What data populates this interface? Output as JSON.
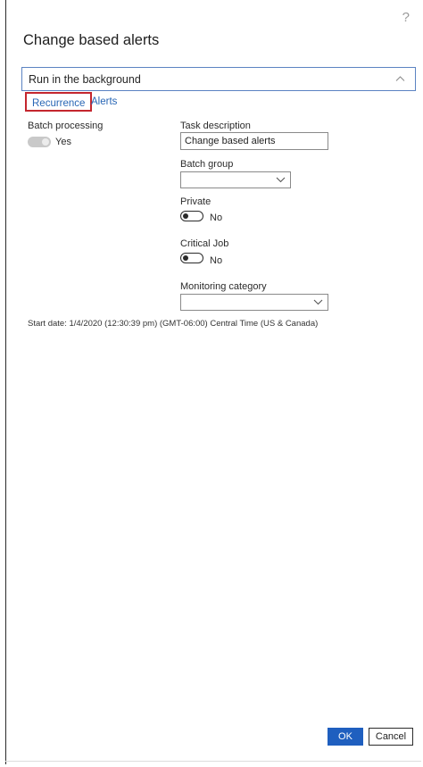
{
  "dialog": {
    "title": "Change based alerts",
    "help_glyph": "?"
  },
  "section": {
    "title": "Run in the background",
    "collapse_icon": "chevron-up-icon"
  },
  "tabs": [
    {
      "label": "Recurrence",
      "highlighted": true
    },
    {
      "label": "Alerts",
      "highlighted": false
    }
  ],
  "batch_processing": {
    "label": "Batch processing",
    "value": "Yes",
    "enabled": false
  },
  "task_description": {
    "label": "Task description",
    "value": "Change based alerts"
  },
  "batch_group": {
    "label": "Batch group",
    "value": ""
  },
  "private": {
    "label": "Private",
    "value": "No"
  },
  "critical_job": {
    "label": "Critical Job",
    "value": "No"
  },
  "monitoring_category": {
    "label": "Monitoring category",
    "value": ""
  },
  "start_date_text": "Start date: 1/4/2020 (12:30:39 pm) (GMT-06:00) Central Time (US & Canada)",
  "buttons": {
    "ok": "OK",
    "cancel": "Cancel"
  },
  "colors": {
    "accent": "#1f5fbf",
    "link": "#2866b5",
    "highlight_border": "#c4262e",
    "section_border": "#5b83c2"
  }
}
